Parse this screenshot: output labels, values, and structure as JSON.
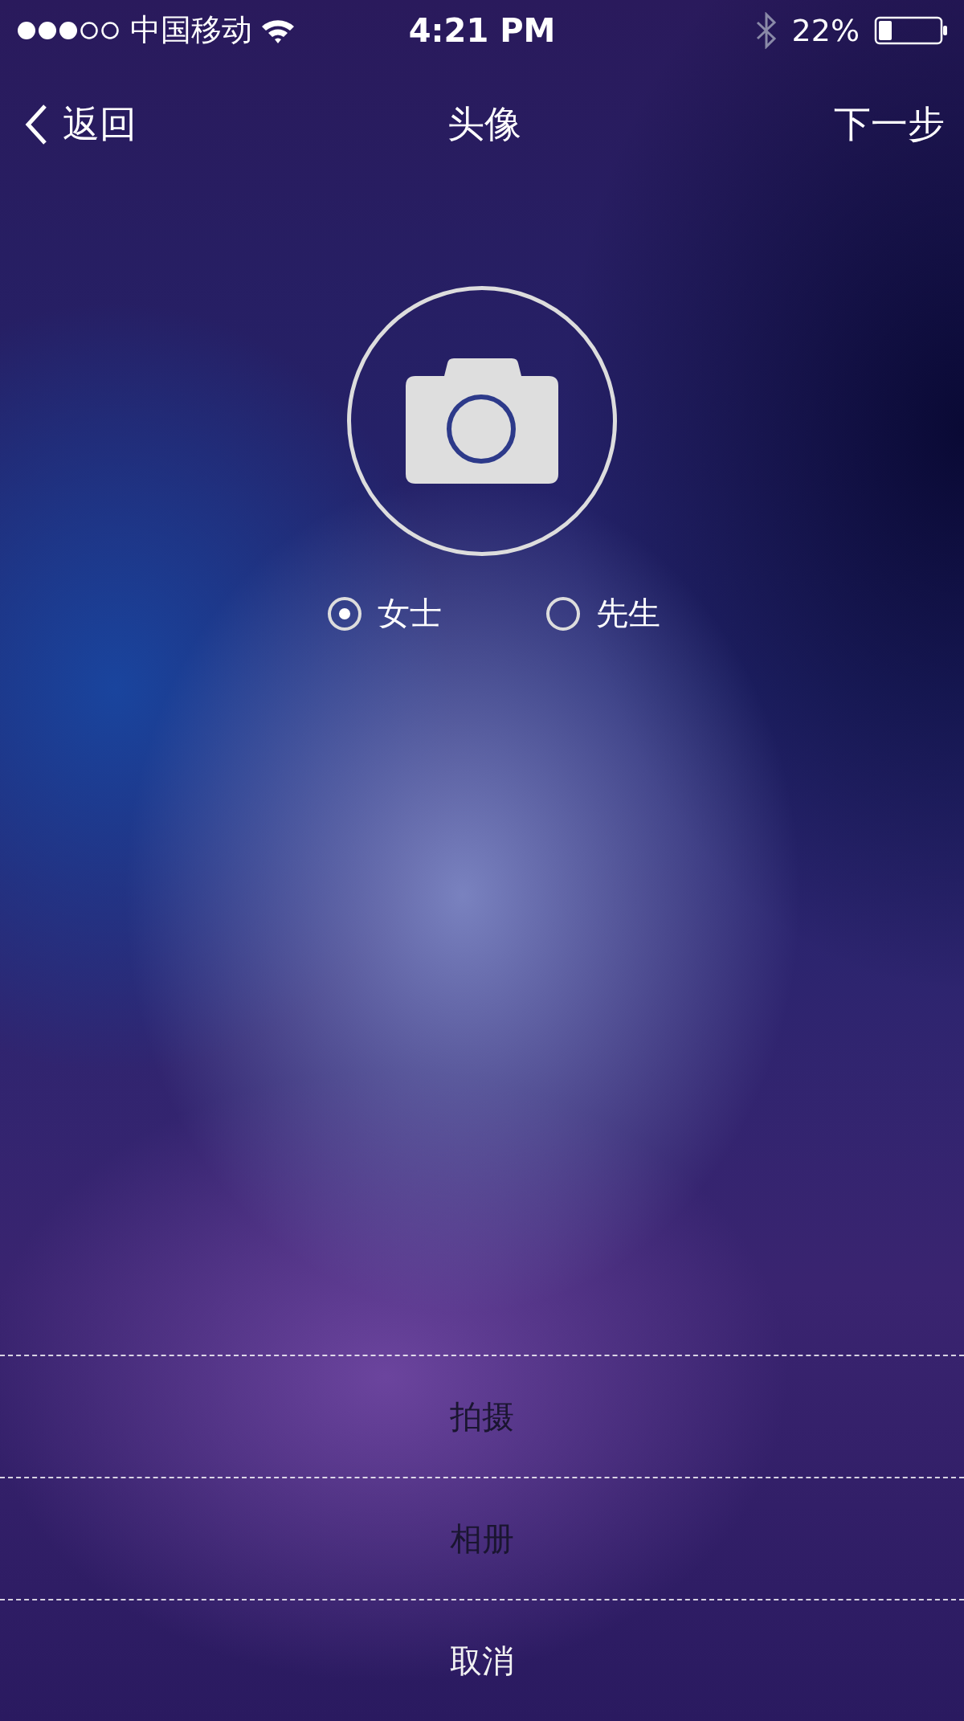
{
  "status_bar": {
    "carrier": "中国移动",
    "time": "4:21 PM",
    "battery": "22%"
  },
  "nav": {
    "back": "返回",
    "title": "头像",
    "next": "下一步"
  },
  "gender": [
    {
      "label": "女士",
      "selected": true
    },
    {
      "label": "先生",
      "selected": false
    }
  ],
  "actions": [
    {
      "label": "拍摄",
      "kind": "option"
    },
    {
      "label": "相册",
      "kind": "option"
    },
    {
      "label": "取消",
      "kind": "cancel"
    }
  ]
}
